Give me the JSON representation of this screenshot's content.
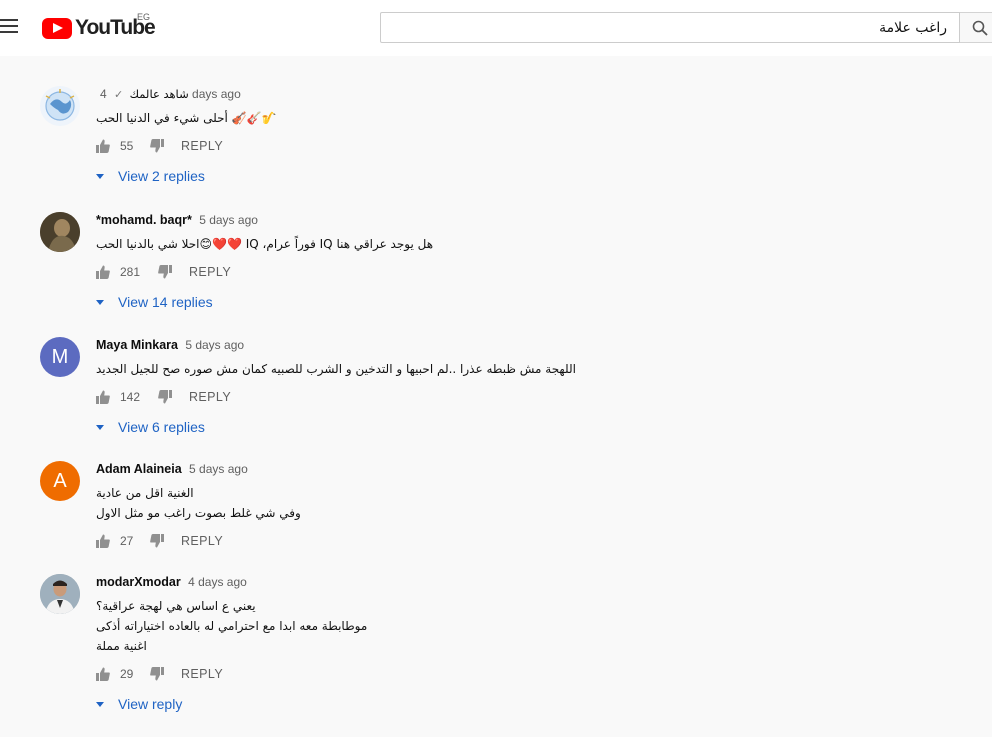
{
  "header": {
    "logo_text": "YouTube",
    "country_code": "EG",
    "search": {
      "value": "راغب علامة",
      "placeholder": ""
    }
  },
  "comments": [
    {
      "author": "شاهد عالمك",
      "verified": "✓",
      "time": "4 days ago",
      "lines": [
        "أحلى شيء في الدنيا الحب 🎻🎸🎷"
      ],
      "likes": "55",
      "reply_label": "REPLY",
      "view_replies": "View 2 replies",
      "avatar": {
        "type": "globe",
        "color": "#6ea3d8"
      }
    },
    {
      "author": "*mohamd. baqr*",
      "time": "5 days ago",
      "lines": [
        "احلا شي بالدنيا الحب😊❤️❤️ IQ ،فوراً عرام IQ هل يوجد عراقي هنا"
      ],
      "likes": "281",
      "reply_label": "REPLY",
      "view_replies": "View 14 replies",
      "avatar": {
        "type": "photo",
        "color": "#6b5a3e"
      }
    },
    {
      "author": "Maya Minkara",
      "time": "5 days ago",
      "lines": [
        "اللهجة مش ظبطه عذرا ..لم احبيها و التدخين و الشرب للصبيه كمان مش صوره صح للجيل الجديد"
      ],
      "likes": "142",
      "reply_label": "REPLY",
      "view_replies": "View 6 replies",
      "avatar": {
        "type": "letter",
        "letter": "M",
        "color": "#5c6bc0"
      }
    },
    {
      "author": "Adam Alaineia",
      "time": "5 days ago",
      "lines": [
        "الغنية اقل من عادية",
        "وفي شي غلط بصوت راغب مو مثل الاول"
      ],
      "likes": "27",
      "reply_label": "REPLY",
      "view_replies": "",
      "avatar": {
        "type": "letter",
        "letter": "A",
        "color": "#ef6c00"
      }
    },
    {
      "author": "modarXmodar",
      "time": "4 days ago",
      "lines": [
        "يعني ع اساس هي لهجة عراقية؟",
        "موطابطة معه ابدا مع احترامي له بالعاده اختياراته أذكى",
        "اغنية مملة"
      ],
      "likes": "29",
      "reply_label": "REPLY",
      "view_replies": "View reply",
      "avatar": {
        "type": "photo2",
        "color": "#8a9aa6"
      }
    }
  ]
}
